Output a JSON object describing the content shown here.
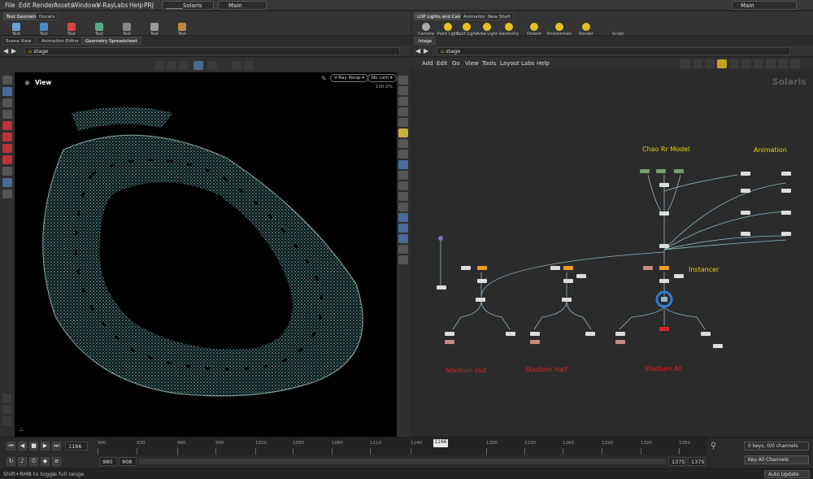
{
  "menubar": {
    "items": [
      "File",
      "Edit",
      "Render",
      "Assets",
      "Windows",
      "V-Ray",
      "Labs",
      "Help",
      "PRJ"
    ],
    "desktop_value": "______Solaris",
    "main_value": "Main",
    "right_value": "Main"
  },
  "left_shelf": {
    "tabs": [
      "Test Geometry",
      "Docars"
    ],
    "tools": [
      "Test Geometry: C...",
      "Test Geometry: P...",
      "Test Geometry: R...",
      "Test Geometry: S...",
      "Test Geometry: T...",
      "Test Geometry: T...",
      "Test Geometry: T..."
    ]
  },
  "right_shelf": {
    "tabs": [
      "LOP Lights and Cameras",
      "Animation",
      "New Shelf"
    ],
    "tools": [
      "Camera",
      "Point Light",
      "Spot Light",
      "Area Light",
      "Geometry Light",
      "Distant Light",
      "Environment Light",
      "Render Physical Sky",
      "Script"
    ]
  },
  "left_panes": {
    "tabs": [
      "Scene View",
      "Animation Editor",
      "Geometry Spreadsheet"
    ],
    "path": "stage"
  },
  "viewport": {
    "label": "View",
    "renderer": "V-Ray Persp",
    "camera": "No cam",
    "zoom": "100.0%"
  },
  "right_panes": {
    "tab": "/stage",
    "path": "stage",
    "menu": [
      "Add",
      "Edit",
      "Go",
      "View",
      "Tools",
      "Layout",
      "Labs",
      "Help"
    ],
    "context": "Solaris"
  },
  "network": {
    "labels_yellow": [
      "Chao Rr Model",
      "Animation",
      "Instancer"
    ],
    "labels_red": [
      "Stadium Out",
      "Stadium Half",
      "Stadium All"
    ]
  },
  "timeline": {
    "current_frame": "1166",
    "ticks": [
      "900",
      "930",
      "960",
      "990",
      "1020",
      "1050",
      "1080",
      "1110",
      "1140",
      "1166",
      "1200",
      "1230",
      "1260",
      "1290",
      "1320",
      "1350"
    ],
    "range_start": "980",
    "range_start2": "908",
    "range_end": "1375",
    "range_end2": "1375",
    "keys_status": "0 keys, 0/0 channels",
    "key_all": "Key All Channels",
    "auto_update": "Auto Update",
    "status_hint": "Shift+RMB to toggle full range"
  },
  "colors": {
    "accent_blue": "#2f7fd6",
    "label_yellow": "#e8d400",
    "label_red": "#dd2222",
    "point_cloud": "#9fd8d0"
  }
}
